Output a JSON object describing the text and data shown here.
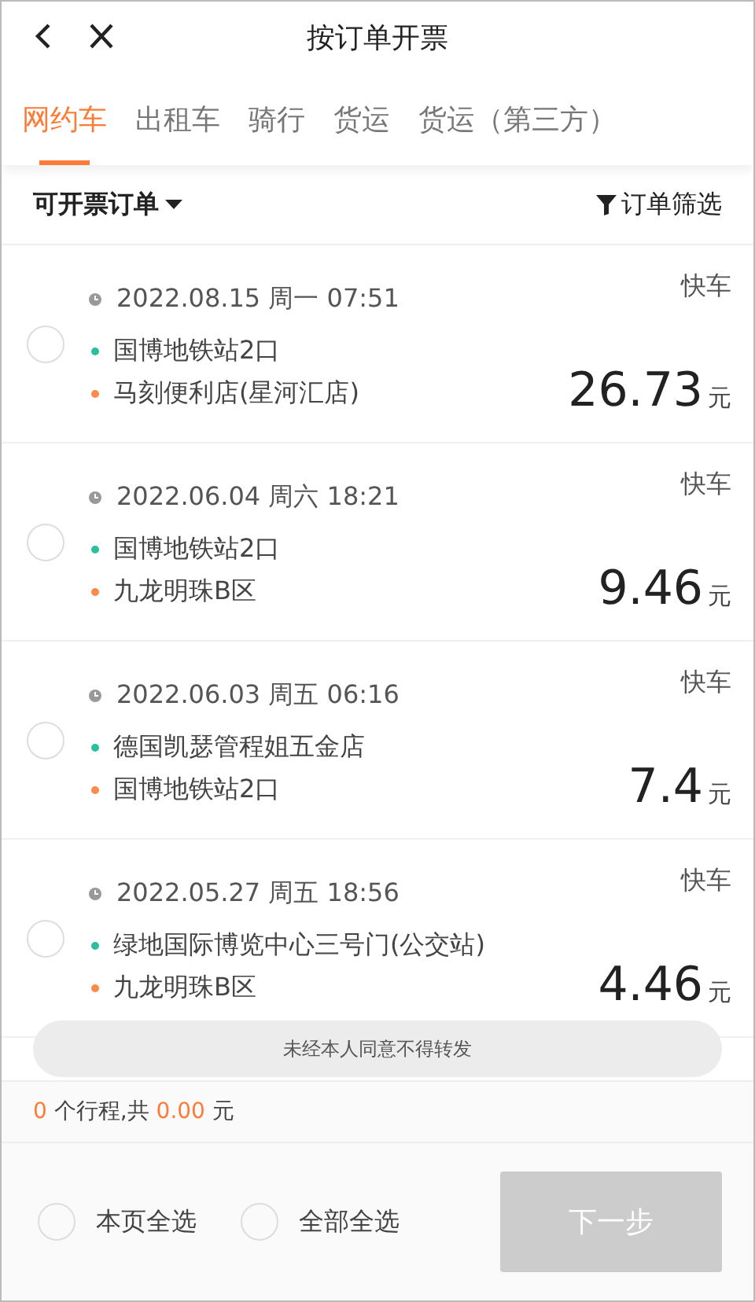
{
  "window": {
    "title": "按订单开票"
  },
  "tabs": [
    {
      "label": "网约车",
      "selected": true
    },
    {
      "label": "出租车",
      "selected": false
    },
    {
      "label": "骑行",
      "selected": false
    },
    {
      "label": "货运",
      "selected": false
    },
    {
      "label": "货运（第三方）",
      "selected": false
    }
  ],
  "filter_bar": {
    "dropdown": "可开票订单",
    "filter": "订单筛选"
  },
  "orders": [
    {
      "time": "2022.08.15 周一 07:51",
      "type": "快车",
      "from": "国博地铁站2口",
      "to": "马刻便利店(星河汇店)",
      "amount": "26.73",
      "unit": "元",
      "checked": false
    },
    {
      "time": "2022.06.04 周六 18:21",
      "type": "快车",
      "from": "国博地铁站2口",
      "to": "九龙明珠B区",
      "amount": "9.46",
      "unit": "元",
      "checked": false
    },
    {
      "time": "2022.06.03 周五 06:16",
      "type": "快车",
      "from": "德国凯瑟管程姐五金店",
      "to": "国博地铁站2口",
      "amount": "7.4",
      "unit": "元",
      "checked": false
    },
    {
      "time": "2022.05.27 周五 18:56",
      "type": "快车",
      "from": "绿地国际博览中心三号门(公交站)",
      "to": "九龙明珠B区",
      "amount": "4.46",
      "unit": "元",
      "checked": false
    }
  ],
  "toast": "未经本人同意不得转发",
  "summary": {
    "count": "0",
    "count_label": "个行程,共",
    "total": "0.00",
    "unit": "元"
  },
  "footer": {
    "select_page": {
      "label": "本页全选",
      "checked": false
    },
    "select_all": {
      "label": "全部全选",
      "checked": false
    },
    "next_button": {
      "label": "下一步",
      "disabled": true
    }
  }
}
